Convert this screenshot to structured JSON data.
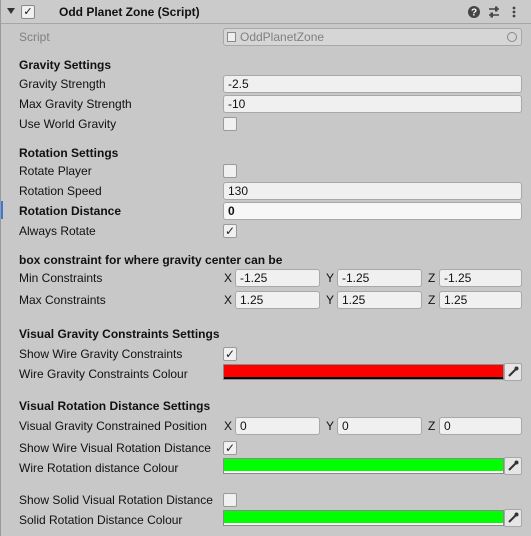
{
  "header": {
    "title": "Odd Planet Zone (Script)",
    "enabled": true,
    "help_icon": "help-icon",
    "settings_icon": "sliders-icon",
    "menu_icon": "kebab-menu-icon"
  },
  "script": {
    "label": "Script",
    "value": "OddPlanetZone"
  },
  "gravity": {
    "title": "Gravity Settings",
    "strength_label": "Gravity Strength",
    "strength_value": "-2.5",
    "max_label": "Max Gravity Strength",
    "max_value": "-10",
    "world_label": "Use World Gravity",
    "world_checked": false
  },
  "rotation": {
    "title": "Rotation Settings",
    "rotate_player_label": "Rotate Player",
    "rotate_player_checked": false,
    "speed_label": "Rotation Speed",
    "speed_value": "130",
    "distance_label": "Rotation Distance",
    "distance_value": "0",
    "always_label": "Always Rotate",
    "always_checked": true
  },
  "box": {
    "title": "box constraint for where gravity center can be",
    "min_label": "Min Constraints",
    "min": {
      "x": "-1.25",
      "y": "-1.25",
      "z": "-1.25"
    },
    "max_label": "Max Constraints",
    "max": {
      "x": "1.25",
      "y": "1.25",
      "z": "1.25"
    },
    "axis": {
      "x": "X",
      "y": "Y",
      "z": "Z"
    }
  },
  "visual_gravity": {
    "title": "Visual Gravity Constraints Settings",
    "show_label": "Show Wire Gravity Constraints",
    "show_checked": true,
    "colour_label": "Wire Gravity Constraints Colour",
    "colour": "#ff0000"
  },
  "visual_rotation": {
    "title": "Visual Rotation Distance Settings",
    "pos_label": "Visual Gravity Constrained Position",
    "pos": {
      "x": "0",
      "y": "0",
      "z": "0"
    },
    "show_wire_label": "Show Wire Visual Rotation Distance",
    "show_wire_checked": true,
    "wire_colour_label": "Wire Rotation distance Colour",
    "wire_colour": "#00ff00",
    "show_solid_label": "Show Solid Visual Rotation Distance",
    "show_solid_checked": false,
    "solid_colour_label": "Solid Rotation Distance Colour",
    "solid_colour": "#00ff00"
  },
  "check_glyph": "✓"
}
